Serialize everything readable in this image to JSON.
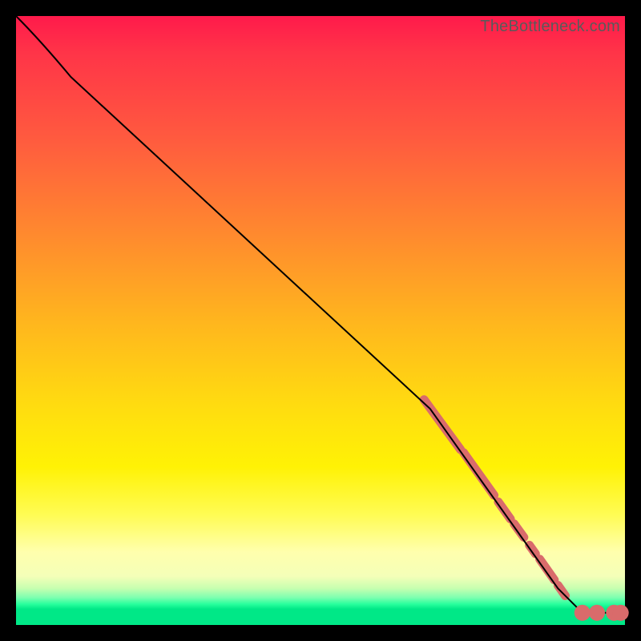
{
  "watermark": "TheBottleneck.com",
  "colors": {
    "segment": "#d96b6b",
    "dot": "#d96b6b",
    "curve": "#000000"
  },
  "chart_data": {
    "type": "line",
    "title": "",
    "xlabel": "",
    "ylabel": "",
    "xlim": [
      0,
      100
    ],
    "ylim": [
      0,
      100
    ],
    "grid": false,
    "legend": null,
    "series": [
      {
        "name": "curve",
        "kind": "path",
        "points": [
          {
            "x": 0,
            "y": 100
          },
          {
            "x": 4,
            "y": 96
          },
          {
            "x": 9,
            "y": 90
          },
          {
            "x": 68,
            "y": 35.5
          },
          {
            "x": 89,
            "y": 6
          },
          {
            "x": 93,
            "y": 2
          },
          {
            "x": 100,
            "y": 2
          }
        ]
      },
      {
        "name": "highlight-segments",
        "kind": "thick-segments",
        "segments": [
          {
            "x1": 67,
            "y1": 37,
            "x2": 73,
            "y2": 28.8
          },
          {
            "x1": 73.5,
            "y1": 28.3,
            "x2": 78.5,
            "y2": 21.3
          },
          {
            "x1": 79.2,
            "y1": 20.2,
            "x2": 81.2,
            "y2": 17.4
          },
          {
            "x1": 81.8,
            "y1": 16.6,
            "x2": 83.4,
            "y2": 14.4
          },
          {
            "x1": 84.3,
            "y1": 13.1,
            "x2": 85.3,
            "y2": 11.7
          },
          {
            "x1": 86.0,
            "y1": 10.8,
            "x2": 88.4,
            "y2": 7.4
          },
          {
            "x1": 89.0,
            "y1": 6.5,
            "x2": 90.2,
            "y2": 4.8
          }
        ]
      },
      {
        "name": "highlight-dots",
        "kind": "dots",
        "r": 5.5,
        "points": [
          {
            "x": 93.0,
            "y": 2.0
          },
          {
            "x": 95.4,
            "y": 2.0
          },
          {
            "x": 98.2,
            "y": 2.0
          },
          {
            "x": 99.3,
            "y": 2.0
          }
        ]
      }
    ]
  }
}
